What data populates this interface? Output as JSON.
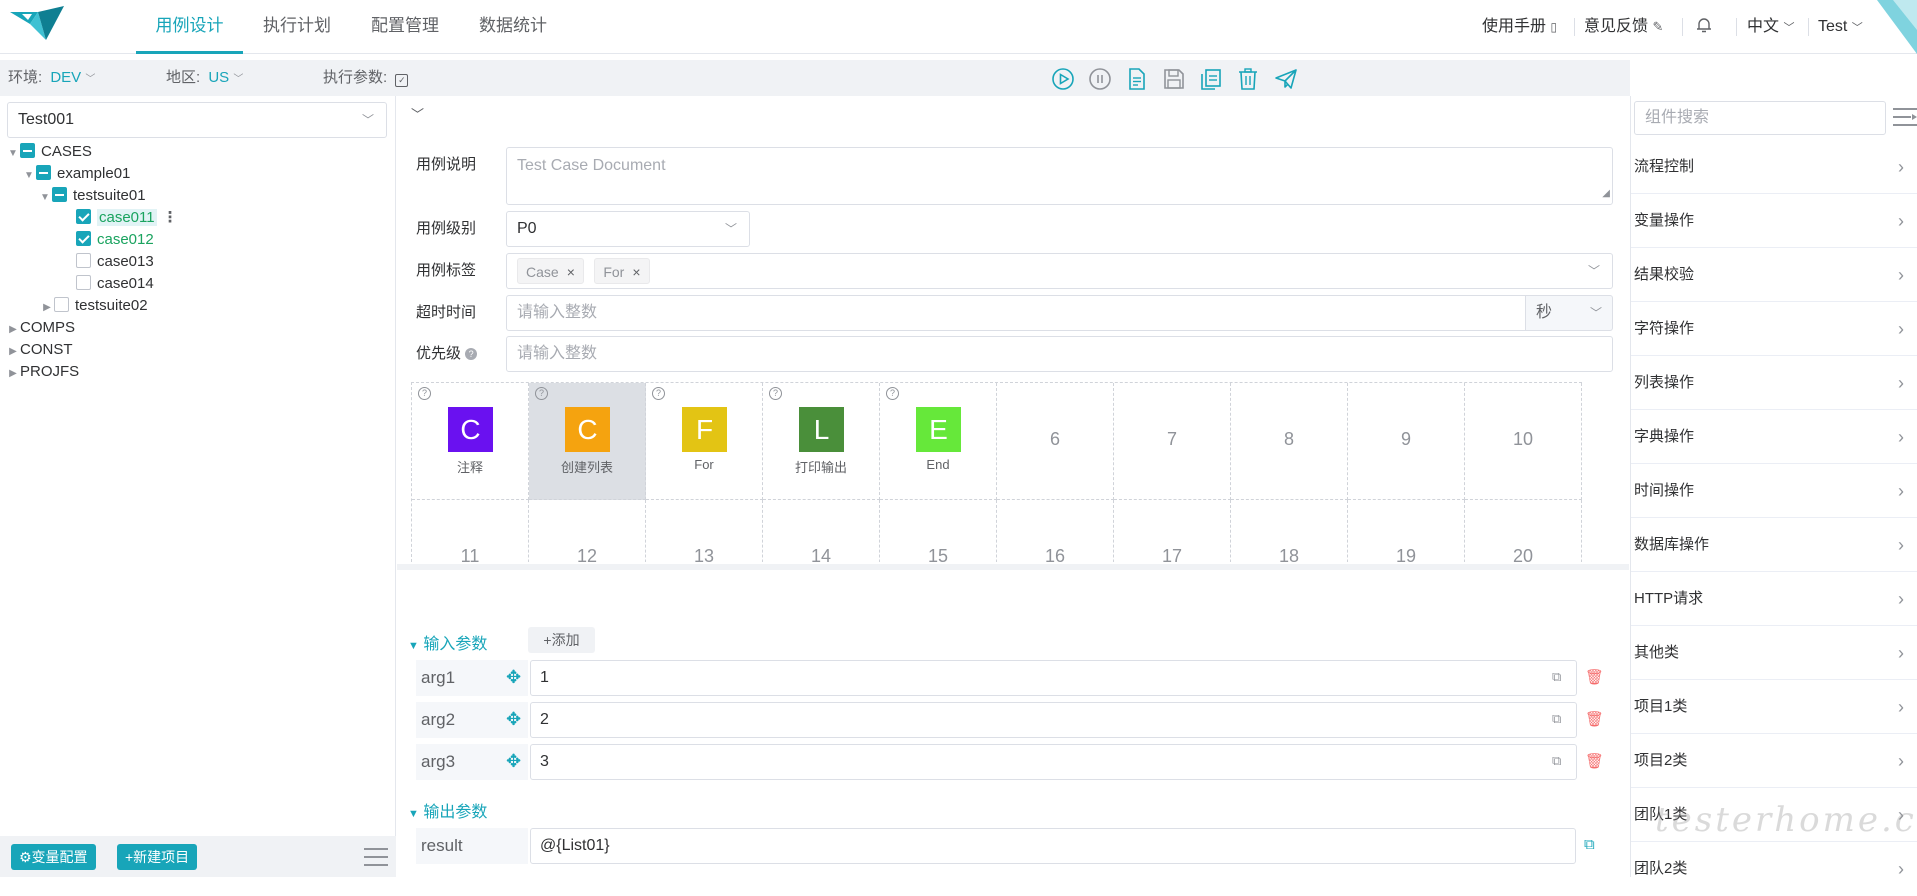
{
  "nav": {
    "tabs": [
      "用例设计",
      "执行计划",
      "配置管理",
      "数据统计"
    ],
    "manual": "使用手册",
    "feedback": "意见反馈",
    "language": "中文",
    "user": "Test"
  },
  "toolbar": {
    "env_label": "环境:",
    "env_value": "DEV",
    "region_label": "地区:",
    "region_value": "US",
    "exec_params_label": "执行参数:",
    "actions": [
      "run-icon",
      "pause-icon",
      "document-icon",
      "save-icon",
      "copy-icon",
      "delete-icon",
      "send-icon"
    ]
  },
  "tree": {
    "selected_case": "Test001",
    "nodes": {
      "cases": "CASES",
      "example01": "example01",
      "testsuite01": "testsuite01",
      "case011": "case011",
      "case012": "case012",
      "case013": "case013",
      "case014": "case014",
      "testsuite02": "testsuite02",
      "comps": "COMPS",
      "const": "CONST",
      "projfs": "PROJFS"
    },
    "var_config_button": "⚙变量配置",
    "new_project_button": "+新建项目"
  },
  "form": {
    "doc_label": "用例说明",
    "doc_placeholder": "Test Case Document",
    "level_label": "用例级别",
    "level_value": "P0",
    "tags_label": "用例标签",
    "tags": [
      "Case",
      "For"
    ],
    "timeout_label": "超时时间",
    "timeout_placeholder": "请输入整数",
    "timeout_unit": "秒",
    "priority_label": "优先级",
    "priority_placeholder": "请输入整数"
  },
  "grid": {
    "components": [
      {
        "letter": "C",
        "label": "注释",
        "color": "#6a11f0"
      },
      {
        "letter": "C",
        "label": "创建列表",
        "color": "#f5a30f"
      },
      {
        "letter": "F",
        "label": "For",
        "color": "#e3c414"
      },
      {
        "letter": "L",
        "label": "打印输出",
        "color": "#4a8f3a"
      },
      {
        "letter": "E",
        "label": "End",
        "color": "#66e83a"
      }
    ],
    "slots": [
      "6",
      "7",
      "8",
      "9",
      "10",
      "11",
      "12",
      "13",
      "14",
      "15",
      "16",
      "17",
      "18",
      "19",
      "20"
    ]
  },
  "input_params": {
    "title": "输入参数",
    "add_button": "+添加",
    "rows": [
      {
        "name": "arg1",
        "value": "1"
      },
      {
        "name": "arg2",
        "value": "2"
      },
      {
        "name": "arg3",
        "value": "3"
      }
    ]
  },
  "output_params": {
    "title": "输出参数",
    "rows": [
      {
        "name": "result",
        "value": "@{List01}"
      }
    ]
  },
  "right_panel": {
    "search_placeholder": "组件搜索",
    "categories": [
      "流程控制",
      "变量操作",
      "结果校验",
      "字符操作",
      "列表操作",
      "字典操作",
      "时间操作",
      "数据库操作",
      "HTTP请求",
      "其他类",
      "项目1类",
      "项目2类",
      "团队1类",
      "团队2类"
    ]
  },
  "watermark": "testerhome.com",
  "colors": {
    "accent": "#18a5b9",
    "toolbar_bg": "#f0f2f5",
    "danger": "#f56c6c"
  }
}
